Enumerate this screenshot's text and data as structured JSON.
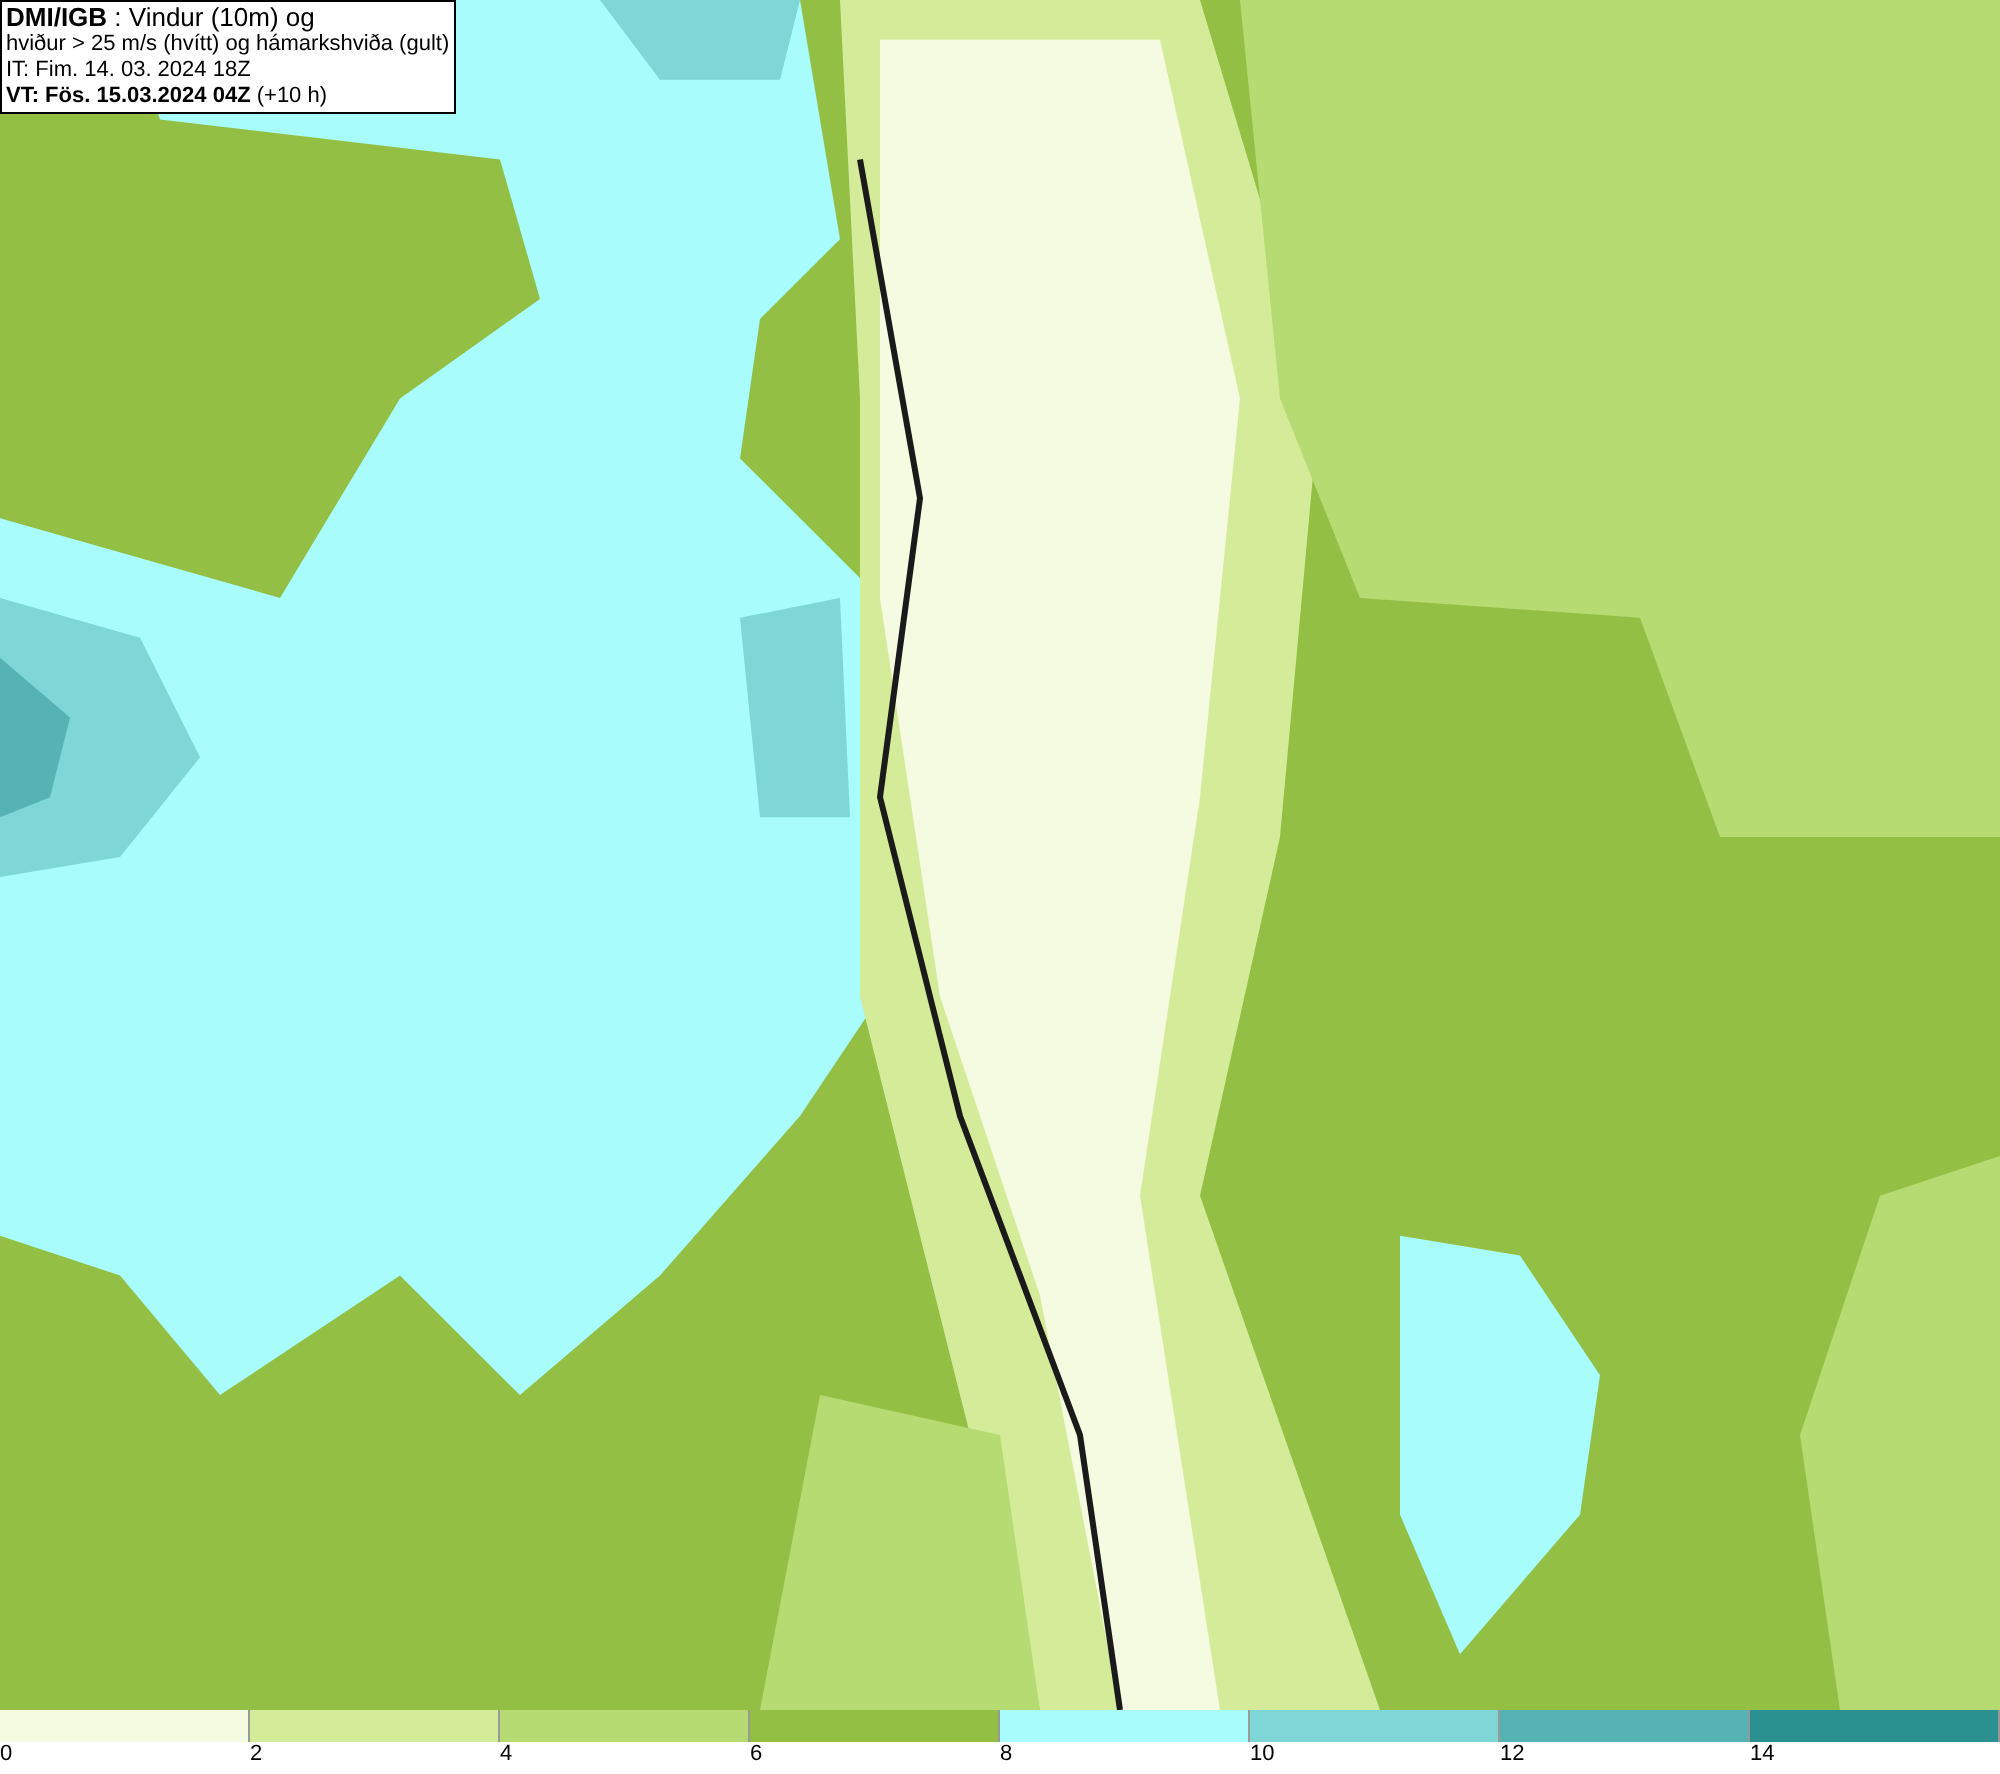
{
  "title_box": {
    "lines": [
      "**DMI/IGB** : Vindur (10m) og",
      "hviður > 25 m/s (hvítt) og hámarkshviða (gult)",
      "IT: Fim. 14. 03. 2024 18Z",
      "**VT: Fös. 15.03.2024 04Z** (+10 h)"
    ]
  },
  "legend": {
    "segments": [
      {
        "label": "0",
        "color": "#f5fbe0"
      },
      {
        "label": "2",
        "color": "#d4ec9a"
      },
      {
        "label": "4",
        "color": "#b6db72"
      },
      {
        "label": "6",
        "color": "#94bf45"
      },
      {
        "label": "8",
        "color": "#a8fcfc"
      },
      {
        "label": "10",
        "color": "#7fd6d6"
      },
      {
        "label": "12",
        "color": "#55b3b3"
      },
      {
        "label": "14",
        "color": "#2a9090"
      }
    ]
  }
}
